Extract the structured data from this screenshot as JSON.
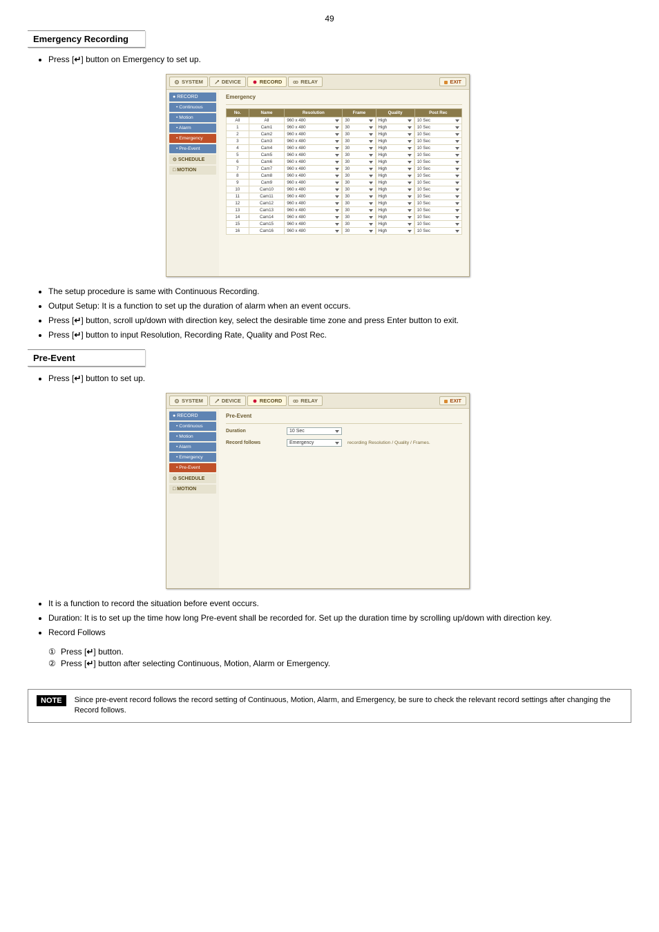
{
  "page_number": "49",
  "sections": {
    "emergency": {
      "title": "Emergency Recording",
      "intro": "Press [",
      "intro_icon": "↵",
      "intro_post": "] button on Emergency to set up."
    },
    "preevent": {
      "title": "Pre-Event",
      "intro": "Press [",
      "intro_icon": "↵",
      "intro_post": "] button to set up."
    }
  },
  "emergency_bullets": [
    "The setup procedure is same with Continuous Recording.",
    "Output Setup: It is a function to set up the duration of alarm when an event occurs.",
    {
      "pre": "Press [",
      "icon": "↵",
      "post": "] button, scroll up/down with direction key, select the desirable time zone and press Enter button to exit."
    },
    {
      "pre": "Press [",
      "icon": "↵",
      "post": "] button to input Resolution, Recording Rate, Quality and Post Rec."
    }
  ],
  "preevent_bullets": [
    "It is a function to record the situation before event occurs.",
    "Duration: It is to set up the time how long Pre-event shall be recorded for. Set up the duration time by scrolling up/down with direction key.",
    "Record Follows"
  ],
  "preevent_steps": [
    {
      "num": "①",
      "pre": "Press [",
      "icon": "↵",
      "post": "] button."
    },
    {
      "num": "②",
      "pre": "Press [",
      "icon": "↵",
      "post": "] button after selecting Continuous, Motion, Alarm or Emergency."
    }
  ],
  "app": {
    "tabs": {
      "system": "SYSTEM",
      "device": "DEVICE",
      "record": "RECORD",
      "relay": "RELAY"
    },
    "exit": "EXIT",
    "sidebar": {
      "record": "RECORD",
      "continuous": "Continuous",
      "motion": "Motion",
      "alarm": "Alarm",
      "emergency": "Emergency",
      "preevent": "Pre-Event",
      "schedule": "SCHEDULE",
      "motion2": "MOTION"
    }
  },
  "emerg_panel": {
    "title": "Emergency",
    "headers": {
      "no": "No.",
      "name": "Name",
      "resolution": "Resolution",
      "frame": "Frame",
      "quality": "Quality",
      "postrec": "Post Rec"
    },
    "all_label": "All",
    "rows": [
      {
        "no": "All",
        "name": "All",
        "res": "960 x 480",
        "frame": "30",
        "quality": "High",
        "post": "10 Sec"
      },
      {
        "no": "1",
        "name": "Cam1",
        "res": "960 x 480",
        "frame": "30",
        "quality": "High",
        "post": "10 Sec"
      },
      {
        "no": "2",
        "name": "Cam2",
        "res": "960 x 480",
        "frame": "30",
        "quality": "High",
        "post": "10 Sec"
      },
      {
        "no": "3",
        "name": "Cam3",
        "res": "960 x 480",
        "frame": "30",
        "quality": "High",
        "post": "10 Sec"
      },
      {
        "no": "4",
        "name": "Cam4",
        "res": "960 x 480",
        "frame": "30",
        "quality": "High",
        "post": "10 Sec"
      },
      {
        "no": "5",
        "name": "Cam5",
        "res": "960 x 480",
        "frame": "30",
        "quality": "High",
        "post": "10 Sec"
      },
      {
        "no": "6",
        "name": "Cam6",
        "res": "960 x 480",
        "frame": "30",
        "quality": "High",
        "post": "10 Sec"
      },
      {
        "no": "7",
        "name": "Cam7",
        "res": "960 x 480",
        "frame": "30",
        "quality": "High",
        "post": "10 Sec"
      },
      {
        "no": "8",
        "name": "Cam8",
        "res": "960 x 480",
        "frame": "30",
        "quality": "High",
        "post": "10 Sec"
      },
      {
        "no": "9",
        "name": "Cam9",
        "res": "960 x 480",
        "frame": "30",
        "quality": "High",
        "post": "10 Sec"
      },
      {
        "no": "10",
        "name": "Cam10",
        "res": "960 x 480",
        "frame": "30",
        "quality": "High",
        "post": "10 Sec"
      },
      {
        "no": "11",
        "name": "Cam11",
        "res": "960 x 480",
        "frame": "30",
        "quality": "High",
        "post": "10 Sec"
      },
      {
        "no": "12",
        "name": "Cam12",
        "res": "960 x 480",
        "frame": "30",
        "quality": "High",
        "post": "10 Sec"
      },
      {
        "no": "13",
        "name": "Cam13",
        "res": "960 x 480",
        "frame": "30",
        "quality": "High",
        "post": "10 Sec"
      },
      {
        "no": "14",
        "name": "Cam14",
        "res": "960 x 480",
        "frame": "30",
        "quality": "High",
        "post": "10 Sec"
      },
      {
        "no": "15",
        "name": "Cam15",
        "res": "960 x 480",
        "frame": "30",
        "quality": "High",
        "post": "10 Sec"
      },
      {
        "no": "16",
        "name": "Cam16",
        "res": "960 x 480",
        "frame": "30",
        "quality": "High",
        "post": "10 Sec"
      }
    ]
  },
  "preevent_panel": {
    "title": "Pre-Event",
    "duration_label": "Duration",
    "duration_value": "10 Sec",
    "follows_label": "Record follows",
    "follows_value": "Emergency",
    "note": "recording Resolution / Quality / Frames."
  },
  "note": {
    "badge": "NOTE",
    "text": "Since pre-event record follows the record setting of Continuous, Motion, Alarm, and Emergency, be sure to check the relevant record settings after changing the Record follows."
  }
}
